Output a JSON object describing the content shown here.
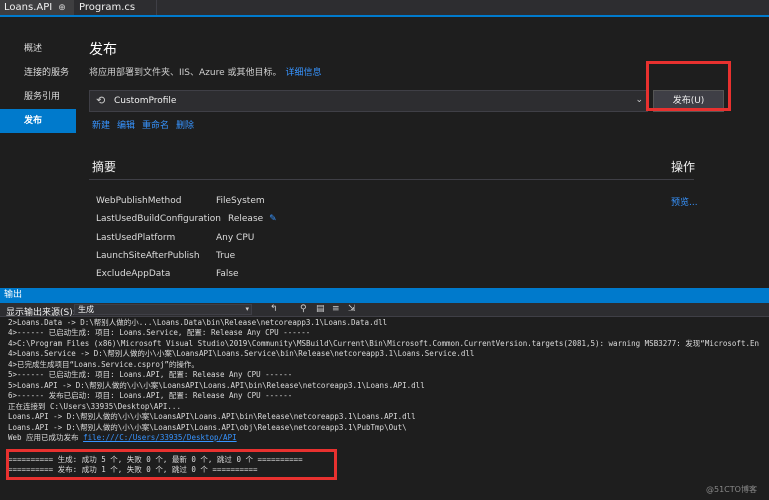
{
  "tabs": [
    {
      "label": "Loans.API",
      "close": "⊕"
    },
    {
      "label": "Program.cs",
      "close": ""
    }
  ],
  "sidebar": {
    "items": [
      {
        "label": "概述"
      },
      {
        "label": "连接的服务"
      },
      {
        "label": "服务引用"
      },
      {
        "label": "发布"
      }
    ]
  },
  "publish": {
    "title": "发布",
    "subtitle": "将应用部署到文件夹、IIS、Azure 或其他目标。",
    "details_link": "详细信息",
    "profile_name": "CustomProfile",
    "publish_button": "发布(U)",
    "actions": [
      "新建",
      "编辑",
      "重命名",
      "删除"
    ]
  },
  "summary": {
    "heading": "摘要",
    "ops_heading": "操作",
    "preview_link": "预览...",
    "properties": [
      {
        "name": "WebPublishMethod",
        "value": "FileSystem"
      },
      {
        "name": "LastUsedBuildConfiguration",
        "value": "Release"
      },
      {
        "name": "LastUsedPlatform",
        "value": "Any CPU"
      },
      {
        "name": "LaunchSiteAfterPublish",
        "value": "True"
      },
      {
        "name": "ExcludeAppData",
        "value": "False"
      }
    ]
  },
  "output": {
    "title": "输出",
    "source_label": "显示输出来源(S):",
    "source_value": "生成",
    "lines": [
      "2>Loans.Data -> D:\\帮别人做的小...\\Loans.Data\\bin\\Release\\netcoreapp3.1\\Loans.Data.dll",
      "4>------ 已启动生成: 项目: Loans.Service, 配置: Release Any CPU ------",
      "4>C:\\Program Files (x86)\\Microsoft Visual Studio\\2019\\Community\\MSBuild\\Current\\Bin\\Microsoft.Common.CurrentVersion.targets(2081,5): warning MSB3277: 发现“Microsoft.En",
      "4>Loans.Service -> D:\\帮别人做的小\\小案\\LoansAPI\\Loans.Service\\bin\\Release\\netcoreapp3.1\\Loans.Service.dll",
      "4>已完成生成项目“Loans.Service.csproj”的操作。",
      "5>------ 已启动生成: 项目: Loans.API, 配置: Release Any CPU ------",
      "5>Loans.API -> D:\\帮别人做的\\小\\小案\\LoansAPI\\Loans.API\\bin\\Release\\netcoreapp3.1\\Loans.API.dll",
      "6>------ 发布已启动: 项目: Loans.API, 配置: Release Any CPU ------",
      "正在连接到 C:\\Users\\33935\\Desktop\\API...",
      "Loans.API -> D:\\帮别人做的\\小\\小案\\LoansAPI\\Loans.API\\bin\\Release\\netcoreapp3.1\\Loans.API.dll",
      "Loans.API -> D:\\帮别人做的\\小\\小案\\LoansAPI\\Loans.API\\obj\\Release\\netcoreapp3.1\\PubTmp\\Out\\"
    ],
    "web_publish_prefix": "Web 应用已成功发布 ",
    "web_publish_link": "file:///C:/Users/33935/Desktop/API",
    "result_lines": [
      "========== 生成: 成功 5 个, 失败 0 个, 最新 0 个, 跳过 0 个 ==========",
      "========== 发布: 成功 1 个, 失败 0 个, 跳过 0 个 =========="
    ]
  },
  "watermark": "@51CTO博客"
}
